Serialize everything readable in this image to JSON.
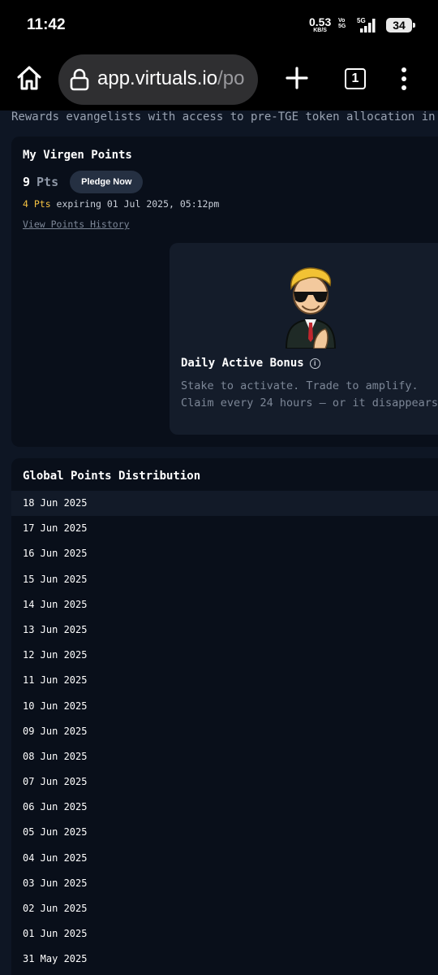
{
  "status_bar": {
    "time": "11:42",
    "net_speed_value": "0.53",
    "net_speed_unit": "KB/S",
    "volte_top": "Vo",
    "volte_bottom": "5G",
    "signal_label": "5G",
    "battery": "34"
  },
  "browser": {
    "url_main": "app.virtuals.io",
    "url_rest": "/po",
    "tab_count": "1"
  },
  "page": {
    "intro": "Rewards evangelists with access to pre-TGE token allocation in gi"
  },
  "points_card": {
    "title": "My Virgen Points",
    "points_value": "9",
    "points_unit": "Pts",
    "pledge_label": "Pledge Now",
    "expiring_pts": "4 Pts",
    "expiring_text": " expiring 01 Jul 2025, 05:12pm",
    "history_link": "View Points History"
  },
  "bonus": {
    "title": "Daily Active Bonus",
    "info_glyph": "i",
    "line1": "Stake to activate. Trade to amplify.",
    "line2": "Claim every 24 hours — or it disappears"
  },
  "distribution": {
    "title": "Global Points Distribution",
    "dates": [
      "18 Jun 2025",
      "17 Jun 2025",
      "16 Jun 2025",
      "15 Jun 2025",
      "14 Jun 2025",
      "13 Jun 2025",
      "12 Jun 2025",
      "11 Jun 2025",
      "10 Jun 2025",
      "09 Jun 2025",
      "08 Jun 2025",
      "07 Jun 2025",
      "06 Jun 2025",
      "05 Jun 2025",
      "04 Jun 2025",
      "03 Jun 2025",
      "02 Jun 2025",
      "01 Jun 2025",
      "31 May 2025"
    ]
  },
  "colors": {
    "background": "#0e1624",
    "card": "#090f1a",
    "accent_gold": "#f5c242",
    "muted": "#7d8797"
  }
}
